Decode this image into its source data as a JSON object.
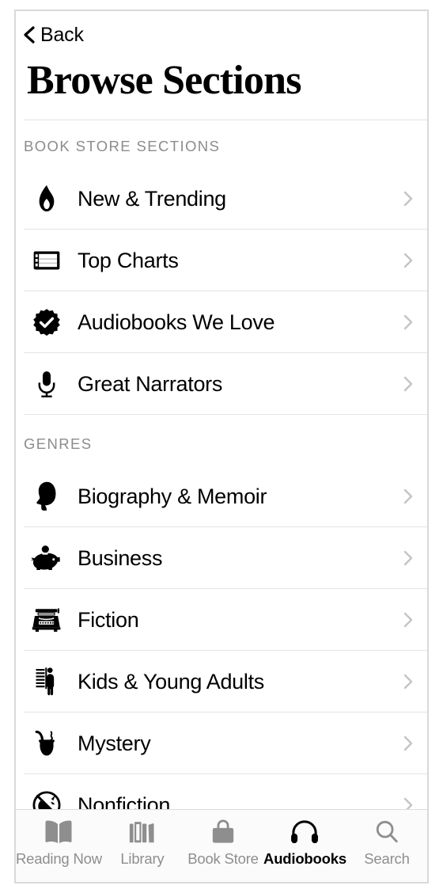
{
  "nav": {
    "back_label": "Back",
    "back_icon": "chevron-left-icon",
    "title": "Browse Sections"
  },
  "sections": [
    {
      "id": "book-store-sections",
      "header": "BOOK STORE SECTIONS",
      "rows": [
        {
          "label": "New & Trending",
          "icon": "flame-icon",
          "disclosure": "chevron-right-icon"
        },
        {
          "label": "Top Charts",
          "icon": "chart-list-icon",
          "disclosure": "chevron-right-icon"
        },
        {
          "label": "Audiobooks We Love",
          "icon": "seal-checkmark-icon",
          "disclosure": "chevron-right-icon"
        },
        {
          "label": "Great Narrators",
          "icon": "microphone-icon",
          "disclosure": "chevron-right-icon"
        }
      ]
    },
    {
      "id": "genres",
      "header": "GENRES",
      "rows": [
        {
          "label": "Biography & Memoir",
          "icon": "profile-silhouette-icon",
          "disclosure": "chevron-right-icon"
        },
        {
          "label": "Business",
          "icon": "piggy-bank-icon",
          "disclosure": "chevron-right-icon"
        },
        {
          "label": "Fiction",
          "icon": "typewriter-icon",
          "disclosure": "chevron-right-icon"
        },
        {
          "label": "Kids & Young Adults",
          "icon": "child-height-chart-icon",
          "disclosure": "chevron-right-icon"
        },
        {
          "label": "Mystery",
          "icon": "smoking-pipe-icon",
          "disclosure": "chevron-right-icon"
        },
        {
          "label": "Nonfiction",
          "icon": "no-unicorn-icon",
          "disclosure": "chevron-right-icon"
        }
      ]
    }
  ],
  "tab_bar": {
    "active": "Audiobooks",
    "tabs": [
      {
        "label": "Reading Now",
        "icon": "open-book-icon",
        "active": false
      },
      {
        "label": "Library",
        "icon": "bookshelf-icon",
        "active": false
      },
      {
        "label": "Book Store",
        "icon": "shopping-bag-icon",
        "active": false
      },
      {
        "label": "Audiobooks",
        "icon": "headphones-icon",
        "active": true
      },
      {
        "label": "Search",
        "icon": "magnifier-icon",
        "active": false
      }
    ]
  },
  "colors": {
    "text_primary": "#000000",
    "text_secondary": "#8c8c8c",
    "separator": "#e4e4e4",
    "tab_inactive": "#8e8e8e",
    "tab_active": "#000000",
    "tab_bar_background": "#fbfbfb"
  }
}
